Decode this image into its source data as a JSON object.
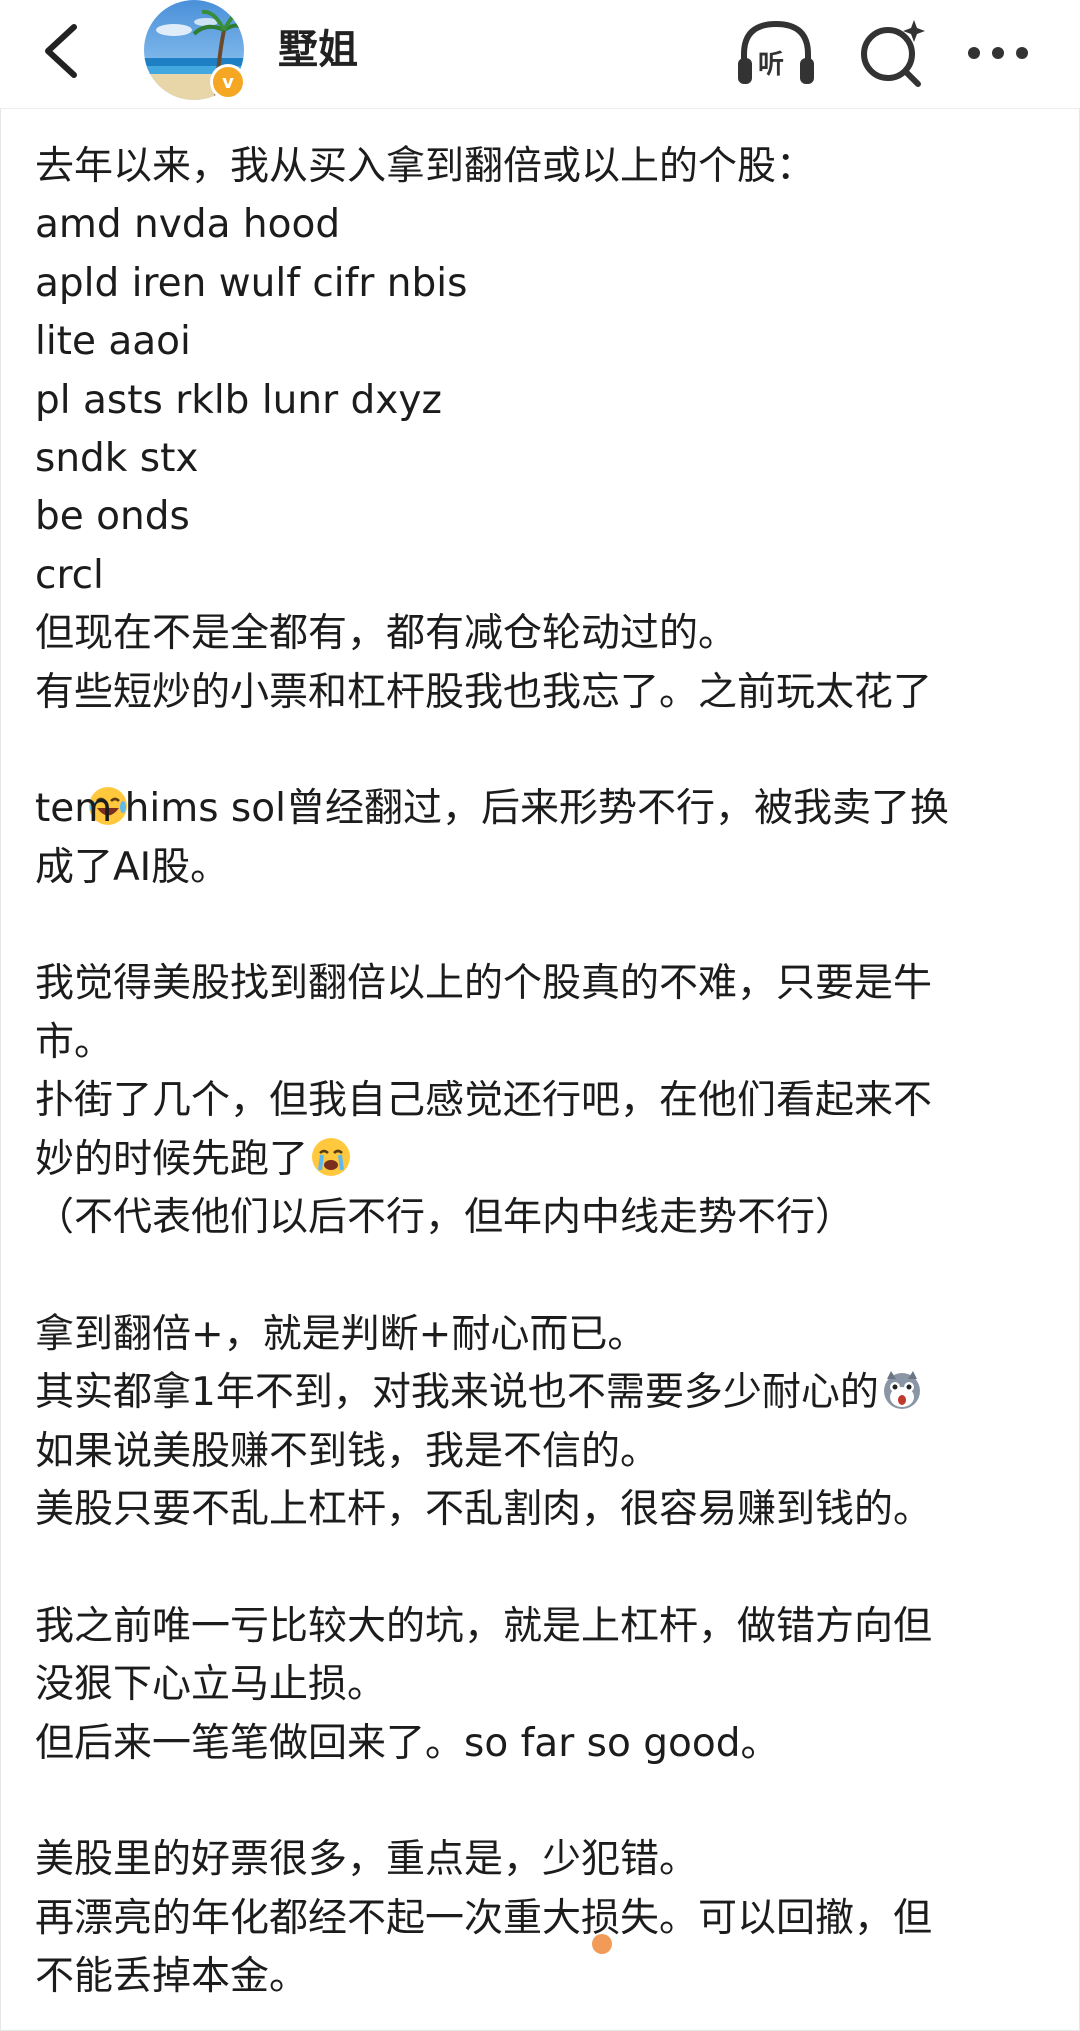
{
  "header": {
    "back_icon": "chevron-left-icon",
    "username": "墅姐",
    "verified_badge": "v",
    "listen_label": "听",
    "accent_color": "#f5a623"
  },
  "post": {
    "lines": [
      "去年以来，我从买入拿到翻倍或以上的个股：",
      "amd nvda hood",
      "apld iren wulf cifr nbis",
      "lite aaoi",
      "pl asts rklb lunr dxyz",
      "sndk stx",
      "be onds",
      "crcl",
      "但现在不是全都有，都有减仓轮动过的。",
      "有些短炒的小票和杠杆股我也我忘了。之前玩太花了",
      "tem hims sol曾经翻过，后来形势不行，被我卖了换",
      "成了AI股。",
      "我觉得美股找到翻倍以上的个股真的不难，只要是牛",
      "市。",
      "扑街了几个，但我自己感觉还行吧，在他们看起来不",
      "妙的时候先跑了",
      "（不代表他们以后不行，但年内中线走势不行）",
      "拿到翻倍+，就是判断+耐心而已。",
      "其实都拿1年不到，对我来说也不需要多少耐心的",
      "如果说美股赚不到钱，我是不信的。",
      "美股只要不乱上杠杆，不乱割肉，很容易赚到钱的。",
      "我之前唯一亏比较大的坑，就是上杠杆，做错方向但",
      "没狠下心立马止损。",
      "但后来一笔笔做回来了。so far so good。",
      "美股里的好票很多，重点是，少犯错。",
      "再漂亮的年化都经不起一次重大损失。可以回撤，但",
      "不能丢掉本金。"
    ],
    "emojis": [
      "laugh-cry-emoji",
      "crying-emoji",
      "shocked-husky-emoji"
    ]
  }
}
